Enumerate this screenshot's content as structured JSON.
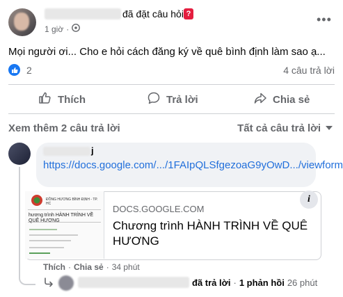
{
  "post": {
    "author_action": "đã đặt câu hỏi",
    "question_badge": "?",
    "time": "1 giờ",
    "text": "Mọi người ơi... Cho e hỏi cách đăng ký về quê bình định làm sao ạ...",
    "like_count": "2",
    "answer_count": "4 câu trả lời"
  },
  "actions": {
    "like": "Thích",
    "reply": "Trả lời",
    "share": "Chia sẻ"
  },
  "comments_header": {
    "see_more": "Xem thêm 2 câu trả lời",
    "filter": "Tất cả câu trả lời"
  },
  "comment": {
    "name_suffix": "j",
    "link_text": "https://docs.google.com/.../1FAIpQLSfgezoaG9yOwD.../viewform",
    "preview": {
      "domain": "DOCS.GOOGLE.COM",
      "title": "Chương trình HÀNH TRÌNH VỀ QUÊ HƯƠNG",
      "thumb_header": "ĐỒNG HƯƠNG BÌNH ĐỊNH - TP. HC",
      "thumb_title": "hương trình HÀNH TRÌNH VỀ QUÊ HƯƠNG",
      "info": "i"
    },
    "like": "Thích",
    "share": "Chia sẻ",
    "time": "34 phút",
    "separator": "·"
  },
  "reply_summary": {
    "action": "đã trả lời",
    "count": "1 phản hồi",
    "time": "26 phút",
    "separator": "·"
  },
  "colors": {
    "link": "#216fdb",
    "like_blue": "#1877f2",
    "secondary_text": "#65676b"
  }
}
